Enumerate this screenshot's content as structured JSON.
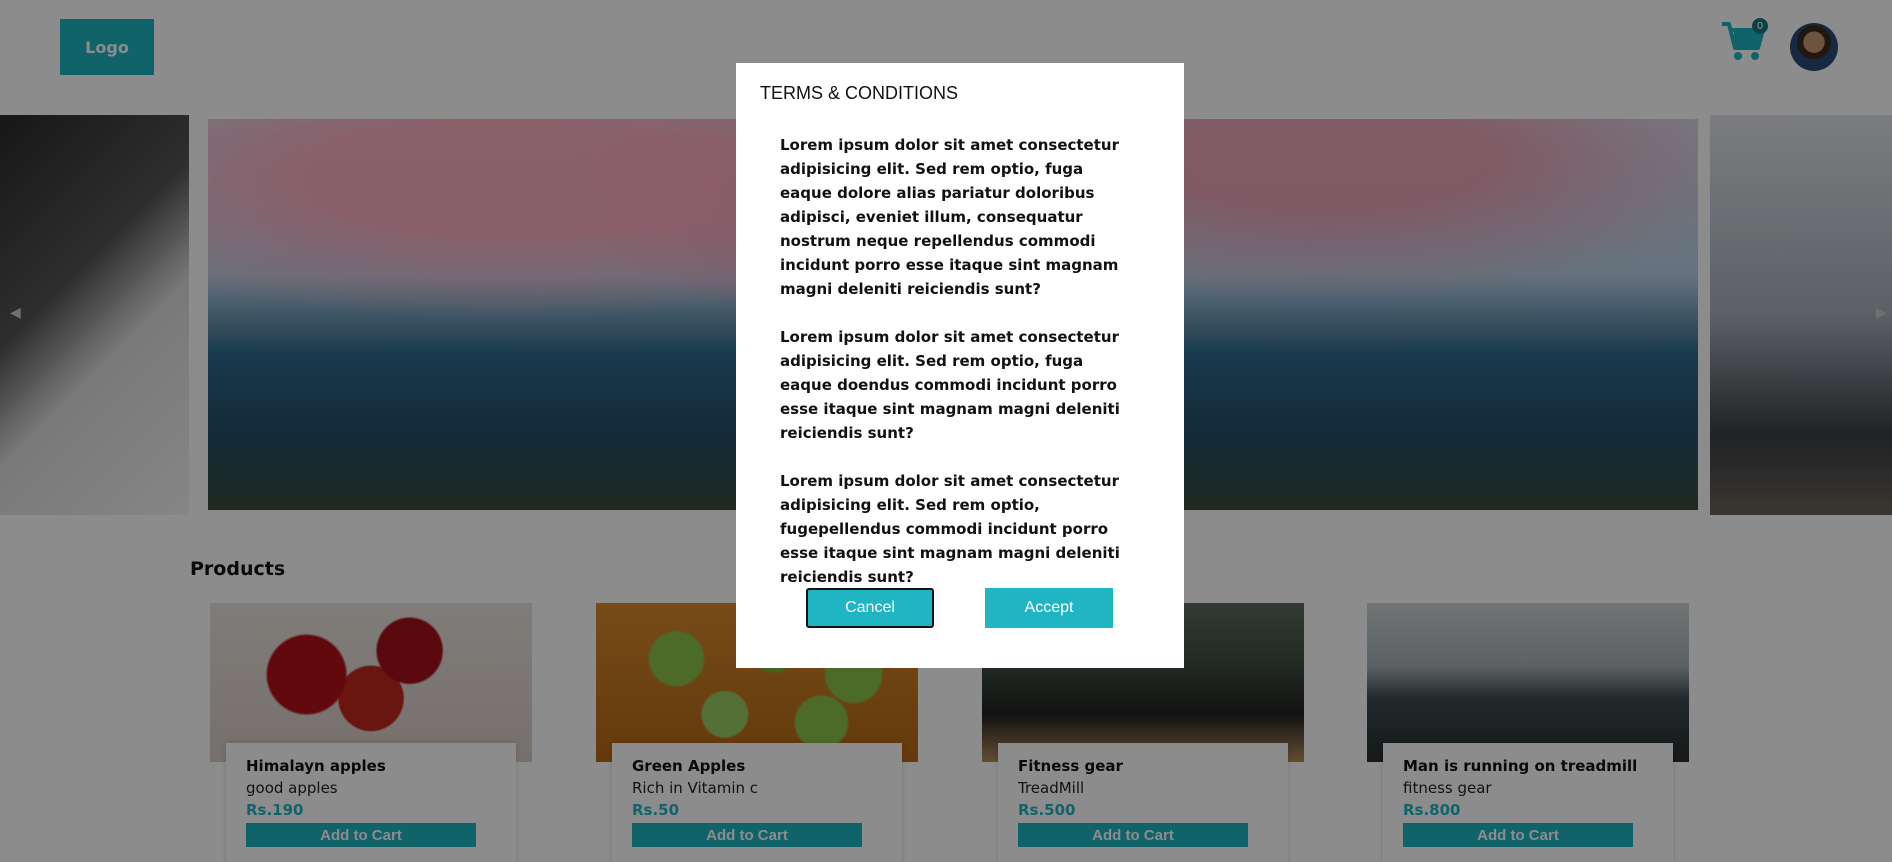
{
  "header": {
    "logo": "Logo",
    "cart_count": "0"
  },
  "products": {
    "title": "Products",
    "items": [
      {
        "name": "Himalayn apples",
        "desc": "good apples",
        "price": "Rs.190",
        "button": "Add to Cart"
      },
      {
        "name": "Green Apples",
        "desc": "Rich in Vitamin c",
        "price": "Rs.50",
        "button": "Add to Cart"
      },
      {
        "name": "Fitness gear",
        "desc": "TreadMill",
        "price": "Rs.500",
        "button": "Add to Cart"
      },
      {
        "name": "Man is running on treadmill",
        "desc": "fitness gear",
        "price": "Rs.800",
        "button": "Add to Cart"
      }
    ]
  },
  "modal": {
    "title": "TERMS & CONDITIONS",
    "paragraphs": [
      "Lorem ipsum dolor sit amet consectetur adipisicing elit. Sed rem optio, fuga eaque dolore alias pariatur doloribus adipisci, eveniet illum, consequatur nostrum neque repellendus commodi incidunt porro esse itaque sint magnam magni deleniti reiciendis sunt?",
      "Lorem ipsum dolor sit amet consectetur adipisicing elit. Sed rem optio, fuga eaque doendus commodi incidunt porro esse itaque sint magnam magni deleniti reiciendis sunt?",
      "Lorem ipsum dolor sit amet consectetur adipisicing elit. Sed rem optio, fugepellendus commodi incidunt porro esse itaque sint magnam magni deleniti reiciendis sunt?"
    ],
    "cancel_label": "Cancel",
    "accept_label": "Accept"
  },
  "icons": {
    "cart": "cart-icon",
    "avatar": "avatar",
    "carousel_prev": "chevron-left-icon",
    "carousel_next": "chevron-right-icon"
  },
  "colors": {
    "accent": "#1fb5c2",
    "overlay": "rgba(0,0,0,0.45)"
  }
}
